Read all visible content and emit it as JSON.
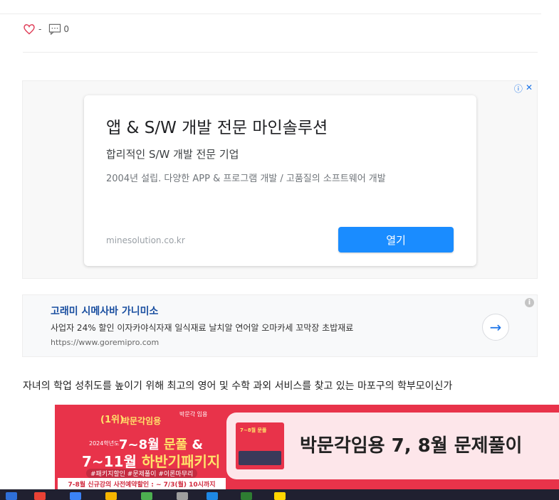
{
  "meta": {
    "like_count": "-",
    "comment_count": "0"
  },
  "ad1": {
    "title": "앱 & S/W 개발 전문 마인솔루션",
    "subtitle": "합리적인 S/W 개발 전문 기업",
    "description": "2004년 설립. 다양한 APP & 프로그램 개발 / 고품질의 소프트웨어 개발",
    "domain": "minesolution.co.kr",
    "open_label": "열기"
  },
  "ad2": {
    "title": "고래미 시메사바 가니미소",
    "description": "사업자 24% 할인 이자카야식자재 일식재료 날치알 연어알 오마카세 꼬막장 초밥재료",
    "url": "https://www.goremipro.com",
    "arrow": "→"
  },
  "paragraph": "자녀의 학업 성취도를 높이기 위해 최고의 영어 및 수학 과외 서비스를 찾고 있는 마포구의 학부모이신가",
  "banner": {
    "rank": "(1위)",
    "publisher": "박문각임용",
    "logo": "박문각 임용",
    "year": "2024학년도",
    "line1_a": "7~8월",
    "line1_b": "문풀",
    "line1_c": "&",
    "line2_a": "7~11월",
    "line2_b": "하반기패키지",
    "tags": "#패키지할인 #문제풀이 #이론마무리",
    "preorder": "7-8월 신규강의 사전예약할인 : ~ 7/3(월) 10시까지",
    "thumb_text": "7~8월 문풀",
    "headline": "박문각임용 7, 8월 문제풀이"
  },
  "colors": {
    "accent": "#1a8cff",
    "banner_red": "#e8334a",
    "link_blue": "#1a4fa0"
  }
}
